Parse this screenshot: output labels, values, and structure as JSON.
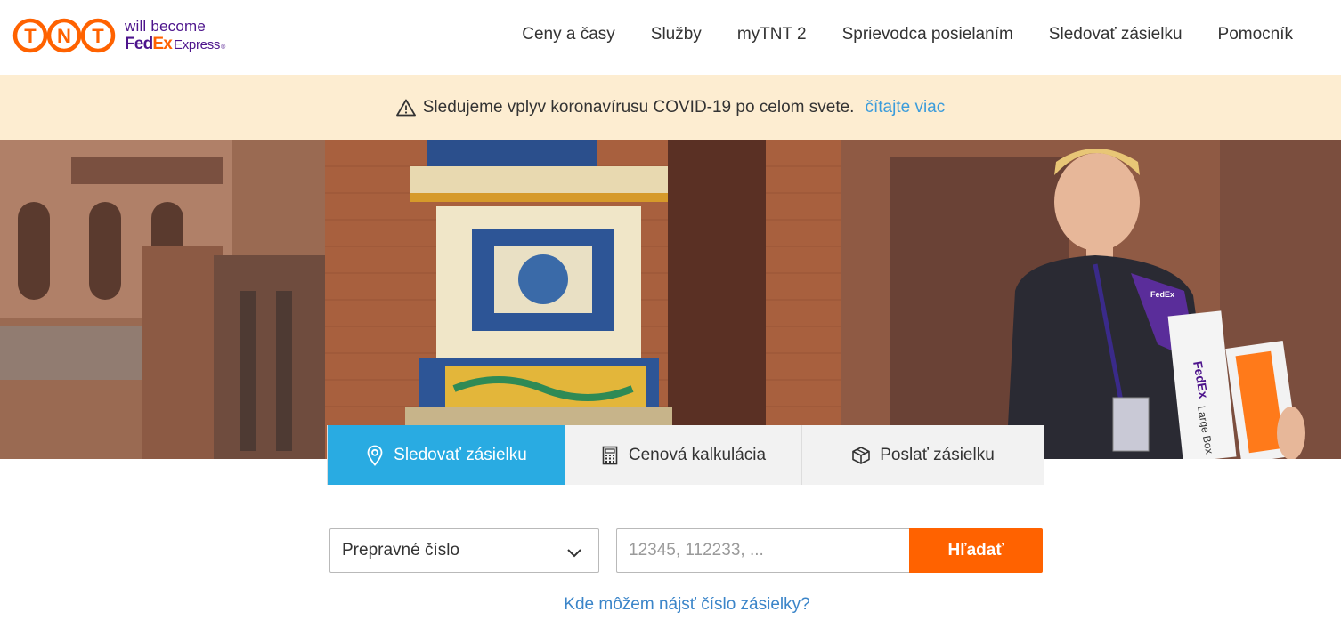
{
  "brand": {
    "logo_text": "TNT",
    "tagline": "will become",
    "fedex_fed": "Fed",
    "fedex_ex": "Ex",
    "fedex_express": "Express",
    "colors": {
      "tnt_orange": "#ff6200",
      "fedex_purple": "#4d148c",
      "fedex_orange": "#ff6200"
    }
  },
  "nav": {
    "items": [
      {
        "label": "Ceny a časy"
      },
      {
        "label": "Služby"
      },
      {
        "label": "myTNT 2"
      },
      {
        "label": "Sprievodca posielaním"
      },
      {
        "label": "Sledovať zásielku"
      },
      {
        "label": "Pomocník"
      }
    ]
  },
  "alert": {
    "icon": "warning-triangle-icon",
    "message": "Sledujeme vplyv koronavírusu COVID-19 po celom svete.",
    "link": "čítajte viac",
    "background": "#fdedd1"
  },
  "hero": {
    "image_alt": "courier-with-packages-hero-image",
    "package_label": "Large Box"
  },
  "tabs": [
    {
      "label": "Sledovať zásielku",
      "icon": "location-pin-icon",
      "active": true
    },
    {
      "label": "Cenová kalkulácia",
      "icon": "calculator-icon",
      "active": false
    },
    {
      "label": "Poslať zásielku",
      "icon": "package-box-icon",
      "active": false
    }
  ],
  "tracking_form": {
    "type_select": {
      "selected": "Prepravné číslo",
      "icon": "chevron-down-icon"
    },
    "number_input": {
      "placeholder": "12345, 112233, ...",
      "value": ""
    },
    "search_button": "Hľadať",
    "help_link": "Kde môžem nájsť číslo zásielky?"
  },
  "colors": {
    "active_tab": "#29abe2",
    "search_button": "#ff6200",
    "link": "#3b9cdb"
  }
}
